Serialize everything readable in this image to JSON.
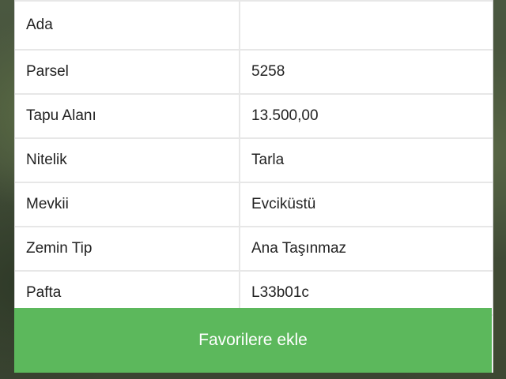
{
  "details": {
    "rows": [
      {
        "label": "Ada",
        "value": ""
      },
      {
        "label": "Parsel",
        "value": "5258"
      },
      {
        "label": "Tapu Alanı",
        "value": "13.500,00"
      },
      {
        "label": "Nitelik",
        "value": "Tarla"
      },
      {
        "label": "Mevkii",
        "value": "Evciküstü"
      },
      {
        "label": "Zemin Tip",
        "value": "Ana Taşınmaz"
      },
      {
        "label": "Pafta",
        "value": "L33b01c"
      }
    ]
  },
  "actions": {
    "favorite_label": "Favorilere ekle"
  },
  "colors": {
    "button": "#5cb85c",
    "divider": "#e7e7e7"
  }
}
